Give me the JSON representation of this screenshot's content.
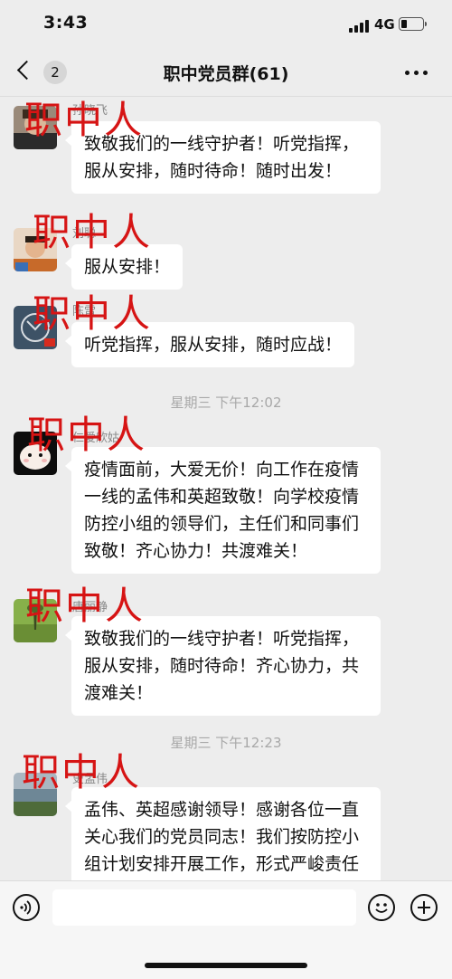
{
  "status_bar": {
    "time": "3:43",
    "network": "4G",
    "battery_level": 0.3
  },
  "nav": {
    "unread_count": "2",
    "title": "职中党员群(61)"
  },
  "watermark_text": "职中人",
  "messages": [
    {
      "sender": "孙晓飞",
      "text": "致敬我们的一线守护者！听党指挥，服从安排，随时待命！随时出发！"
    },
    {
      "sender": "刘聪",
      "text": "服从安排！"
    },
    {
      "sender": "陈雷",
      "text": "听党指挥，服从安排，随时应战！"
    },
    {
      "timestamp": "星期三 下午12:02"
    },
    {
      "sender": "仁爱欣姑",
      "text": "疫情面前，大爱无价！向工作在疫情一线的孟伟和英超致敬！向学校疫情防控小组的领导们，主任们和同事们致敬！齐心协力！共渡难关！"
    },
    {
      "sender": "唐丽静",
      "text": "致敬我们的一线守护者！听党指挥，服从安排，随时待命！齐心协力，共渡难关！"
    },
    {
      "timestamp": "星期三 下午12:23"
    },
    {
      "sender": "史孟伟",
      "text": "孟伟、英超感谢领导！感谢各位一直关心我们的党员同志！我们按防控小组计划安排开展工作，形式严峻责任重大，请放心，我们定会尽"
    }
  ],
  "input_bar": {
    "placeholder": ""
  },
  "colors": {
    "background": "#ededed",
    "bubble": "#ffffff",
    "watermark": "#d61414"
  }
}
